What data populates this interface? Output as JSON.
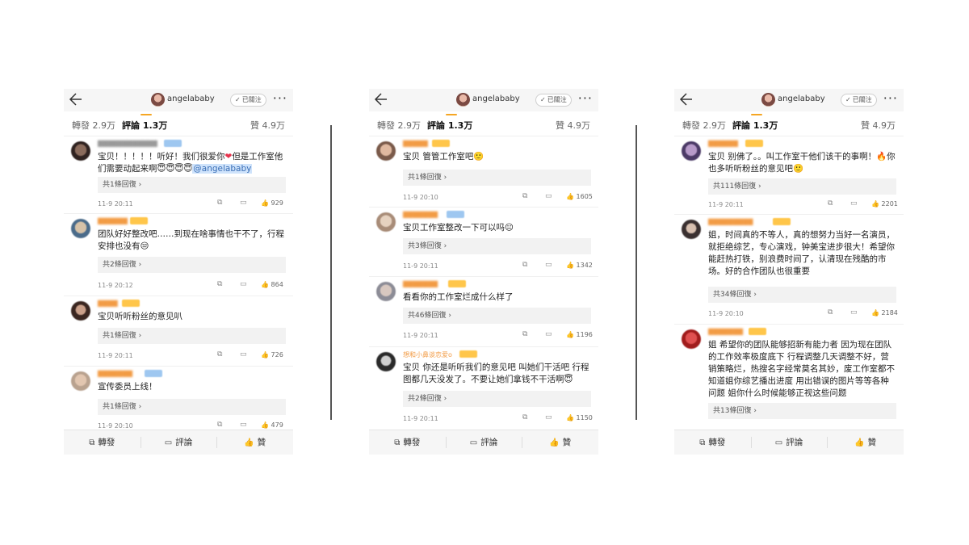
{
  "header": {
    "username": "angelababy",
    "follow_label": "已關注",
    "more": "···"
  },
  "tabs": {
    "repost": "轉發 2.9万",
    "comment": "評論 1.3万",
    "like": "贊 4.9万"
  },
  "bottom_bar": {
    "repost": "轉發",
    "comment": "評論",
    "like": "贊"
  },
  "icons": {
    "share": "⧉",
    "comment": "▭",
    "like": "👍",
    "back": "back-arrow"
  },
  "panels": [
    {
      "comments": [
        {
          "text_before": "宝贝！！！！！听好！我们很爱你",
          "heart": "❤",
          "text_after": "但是工作室他们需要动起来啊😇😇😇😇",
          "mention": "@angelababy",
          "replies": "共1條回復 ›",
          "time": "11-9 20:11",
          "likes": "929"
        },
        {
          "text": "团队好好整改吧……到现在啥事情也干不了，行程安排也没有😒",
          "replies": "共2條回復 ›",
          "time": "11-9 20:12",
          "likes": "864"
        },
        {
          "text": "宝贝听听粉丝的意见叭",
          "replies": "共1條回復 ›",
          "time": "11-9 20:11",
          "likes": "726"
        },
        {
          "text": "宣传委员上线！",
          "replies": "共1條回復 ›",
          "time": "11-9 20:10",
          "likes": "479"
        }
      ]
    },
    {
      "comments": [
        {
          "text": "宝贝 管管工作室吧🙂",
          "replies": "共1條回復 ›",
          "time": "11-9 20:10",
          "likes": "1605"
        },
        {
          "text": "宝贝工作室整改一下可以吗😐",
          "replies": "共3條回復 ›",
          "time": "11-9 20:11",
          "likes": "1342"
        },
        {
          "text": "看看你的工作室烂成什么样了",
          "replies": "共46條回復 ›",
          "time": "11-9 20:11",
          "likes": "1196"
        },
        {
          "name": "想和小鼻谈恋爱o",
          "text": "宝贝 你还是听听我们的意见吧 叫她们干活吧 行程图都几天没发了。不要让她们拿钱不干活啊😇",
          "replies": "共2條回復 ›",
          "time": "11-9 20:11",
          "likes": "1150"
        }
      ]
    },
    {
      "comments": [
        {
          "text": "宝贝 别佛了。。叫工作室干他们该干的事啊！🔥你也多听听粉丝的意见吧🙂",
          "replies": "共111條回復 ›",
          "time": "11-9 20:11",
          "likes": "2201"
        },
        {
          "text": "姐，时间真的不等人，真的想努力当好一名演员，就拒绝综艺，专心演戏，钟美宝进步很大！希望你能赶热打铁，别浪费时间了，认清现在残酷的市场。好的合作团队也很重要",
          "replies": "共34條回復 ›",
          "time": "11-9 20:10",
          "likes": "2184"
        },
        {
          "text": "姐 希望你的团队能够招新有能力者 因为现在团队的工作效率极度底下 行程调整几天调整不好，营销策略烂，热搜名字经常莫名其妙，废工作室都不知道姐你综艺播出进度 用出错误的图片等等各种问题 姐你什么时候能够正视这些问题",
          "replies": "共13條回復 ›",
          "time": "",
          "likes": ""
        }
      ]
    }
  ],
  "colors": {
    "accent": "#f5a623",
    "mention_bg": "#cfe3fb",
    "reply_bg": "#f2f2f2",
    "name_orange": "#f08a24"
  }
}
